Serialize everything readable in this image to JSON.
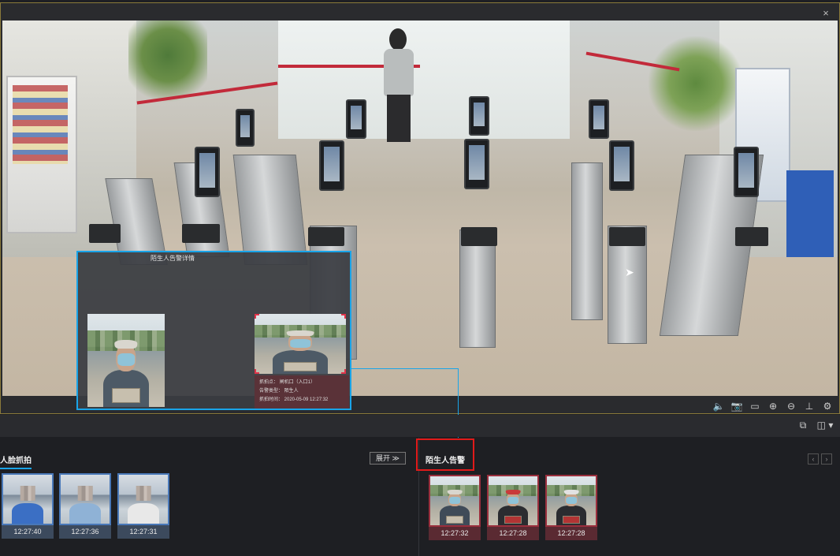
{
  "video": {
    "close_symbol": "×",
    "toolbar": [
      {
        "name": "volume-icon",
        "glyph": "🔈"
      },
      {
        "name": "snapshot-icon",
        "glyph": "📷"
      },
      {
        "name": "record-icon",
        "glyph": "▭"
      },
      {
        "name": "zoom-in-icon",
        "glyph": "⊕"
      },
      {
        "name": "zoom-out-icon",
        "glyph": "⊖"
      },
      {
        "name": "ptz-icon",
        "glyph": "⊥"
      },
      {
        "name": "settings-icon",
        "glyph": "⚙"
      }
    ]
  },
  "popup": {
    "title": "陌生人告警详情",
    "info_rows": [
      "抓拍点：  闸机口（入口1）",
      "告警类型：  陌生人",
      "抓拍时间：  2020-05-09 12:27:32"
    ]
  },
  "panel_bar": {
    "window_icon": "⧉",
    "layout_icon": "◫ ▾"
  },
  "face_capture": {
    "title": "人脸抓拍",
    "expand_label": "展开 ≫",
    "items": [
      {
        "time": "12:27:40",
        "shirt": "#3b6fc4"
      },
      {
        "time": "12:27:36",
        "shirt": "#8fb2d6"
      },
      {
        "time": "12:27:31",
        "shirt": "#e8e8e8"
      }
    ]
  },
  "stranger_alert": {
    "title": "陌生人告警",
    "prev_symbol": "‹",
    "next_symbol": "›",
    "items": [
      {
        "time": "12:27:32"
      },
      {
        "time": "12:27:28"
      },
      {
        "time": "12:27:28"
      }
    ]
  }
}
